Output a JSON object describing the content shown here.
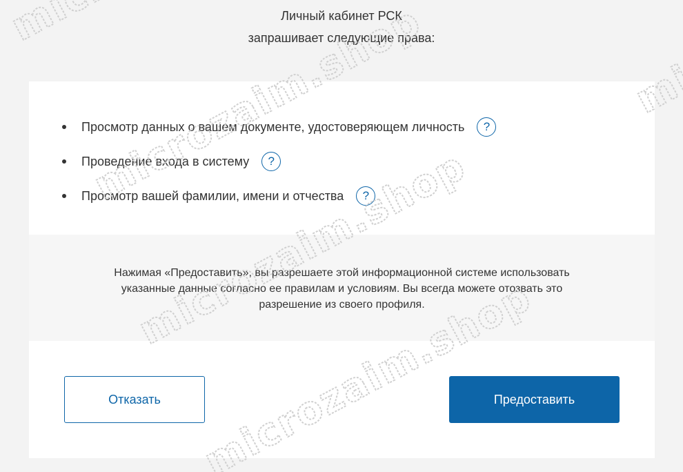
{
  "header": {
    "line1": "Личный кабинет РСК",
    "line2": "запрашивает следующие права:"
  },
  "permissions": [
    {
      "label": "Просмотр данных о вашем документе, удостоверяющем личность",
      "help": "?"
    },
    {
      "label": "Проведение входа в систему",
      "help": "?"
    },
    {
      "label": "Просмотр вашей фамилии, имени и отчества",
      "help": "?"
    }
  ],
  "notice": {
    "line1": "Нажимая «Предоставить», вы разрешаете этой информационной системе использовать",
    "line2": "указанные данные согласно ее правилам и условиям. Вы всегда можете отозвать это",
    "line3": "разрешение из своего профиля."
  },
  "buttons": {
    "decline": "Отказать",
    "grant": "Предоставить"
  },
  "watermark": {
    "text": "microzaim.shop"
  },
  "colors": {
    "accent": "#0d65a8",
    "background": "#f3f3f3",
    "card": "#ffffff",
    "notice_bg": "#f6f6f6"
  }
}
